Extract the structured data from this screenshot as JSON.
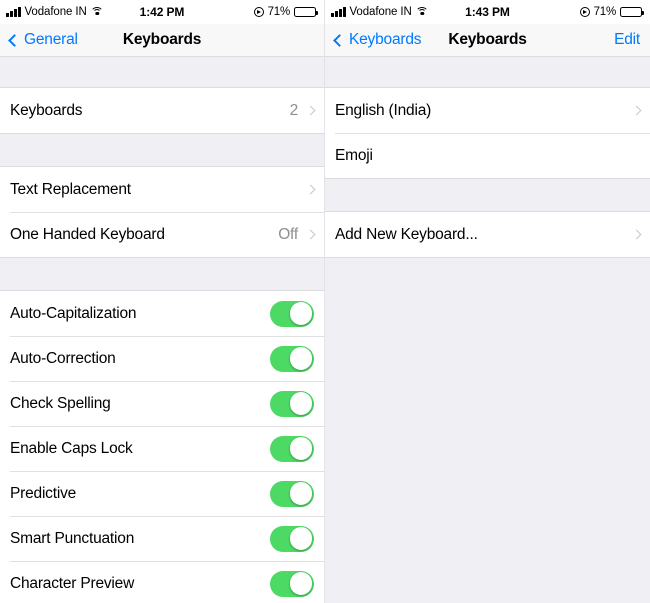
{
  "panels": [
    {
      "status_bar": {
        "signal_icon": "signal-bars-icon",
        "carrier": "Vodafone IN",
        "wifi_icon": "wifi-icon",
        "time": "1:42 PM",
        "location_icon": "location-services-icon",
        "battery_percent": "71%",
        "battery_icon": "battery-icon"
      },
      "nav": {
        "back_label": "General",
        "back_icon": "chevron-left-icon",
        "title": "Keyboards",
        "action_label": ""
      },
      "sections": [
        {
          "rows": [
            {
              "label": "Keyboards",
              "value": "2",
              "type": "disclosure",
              "chevron": true
            }
          ]
        },
        {
          "rows": [
            {
              "label": "Text Replacement",
              "value": "",
              "type": "disclosure",
              "chevron": true
            },
            {
              "label": "One Handed Keyboard",
              "value": "Off",
              "type": "disclosure",
              "chevron": true
            }
          ]
        },
        {
          "rows": [
            {
              "label": "Auto-Capitalization",
              "value": "",
              "type": "toggle",
              "on": true
            },
            {
              "label": "Auto-Correction",
              "value": "",
              "type": "toggle",
              "on": true
            },
            {
              "label": "Check Spelling",
              "value": "",
              "type": "toggle",
              "on": true
            },
            {
              "label": "Enable Caps Lock",
              "value": "",
              "type": "toggle",
              "on": true
            },
            {
              "label": "Predictive",
              "value": "",
              "type": "toggle",
              "on": true
            },
            {
              "label": "Smart Punctuation",
              "value": "",
              "type": "toggle",
              "on": true
            },
            {
              "label": "Character Preview",
              "value": "",
              "type": "toggle",
              "on": true
            }
          ]
        }
      ]
    },
    {
      "status_bar": {
        "signal_icon": "signal-bars-icon",
        "carrier": "Vodafone IN",
        "wifi_icon": "wifi-icon",
        "time": "1:43 PM",
        "location_icon": "location-services-icon",
        "battery_percent": "71%",
        "battery_icon": "battery-icon"
      },
      "nav": {
        "back_label": "Keyboards",
        "back_icon": "chevron-left-icon",
        "title": "Keyboards",
        "action_label": "Edit"
      },
      "sections": [
        {
          "rows": [
            {
              "label": "English (India)",
              "value": "",
              "type": "disclosure",
              "chevron": true
            },
            {
              "label": "Emoji",
              "value": "",
              "type": "plain",
              "chevron": false
            }
          ]
        },
        {
          "rows": [
            {
              "label": "Add New Keyboard...",
              "value": "",
              "type": "disclosure",
              "chevron": true
            }
          ]
        }
      ]
    }
  ],
  "colors": {
    "accent": "#007aff",
    "switch_on": "#4cd964",
    "group_background": "#efeff4",
    "row_background": "#ffffff",
    "value_text": "#8e8e93",
    "chevron": "#c7c7cc"
  }
}
